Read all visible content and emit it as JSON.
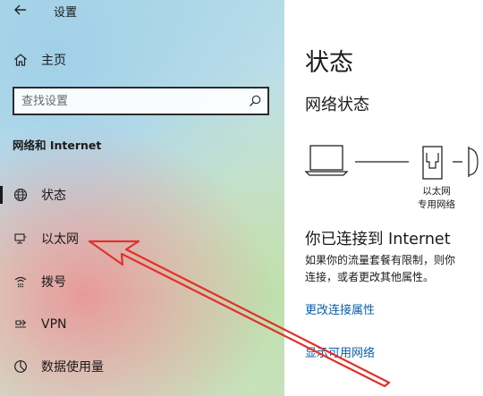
{
  "window": {
    "title": "设置"
  },
  "nav": {
    "home_label": "主页",
    "search_placeholder": "查找设置",
    "section_title": "网络和 Internet",
    "items": [
      {
        "label": "状态",
        "icon": "globe-icon",
        "selected": true
      },
      {
        "label": "以太网",
        "icon": "ethernet-icon",
        "selected": false
      },
      {
        "label": "拨号",
        "icon": "dialup-icon",
        "selected": false
      },
      {
        "label": "VPN",
        "icon": "vpn-icon",
        "selected": false
      },
      {
        "label": "数据使用量",
        "icon": "data-usage-icon",
        "selected": false
      }
    ]
  },
  "content": {
    "page_title": "状态",
    "section_title": "网络状态",
    "diagram": {
      "ethernet_label_line1": "以太网",
      "ethernet_label_line2": "专用网络"
    },
    "connected_text": "你已连接到 Internet",
    "description_line1": "如果你的流量套餐有限制，则你",
    "description_line2": "连接，或者更改其他属性。",
    "link_change_properties": "更改连接属性",
    "link_show_networks": "显示可用网络"
  },
  "colors": {
    "accent_link": "#0a5fa8",
    "annotation_arrow": "#e0322a"
  }
}
